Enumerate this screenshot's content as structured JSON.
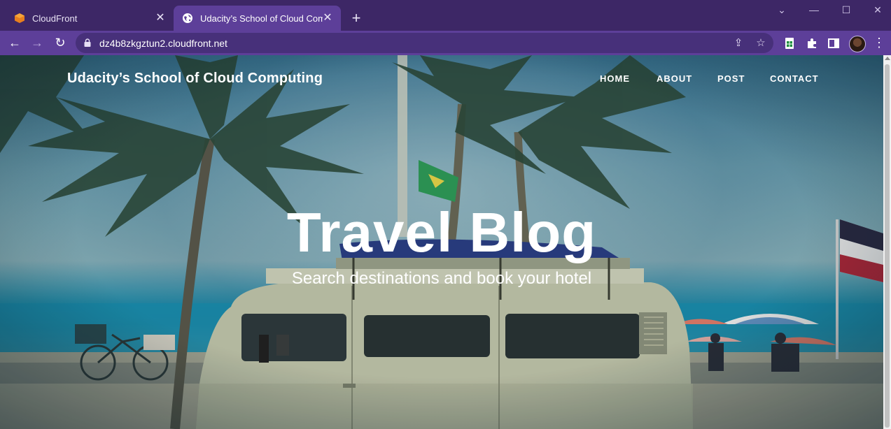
{
  "browser": {
    "tabs": [
      {
        "title": "CloudFront",
        "active": false
      },
      {
        "title": "Udacity’s School of Cloud Computing",
        "active": true
      }
    ],
    "address": "dz4b8zkgztun2.cloudfront.net",
    "colors": {
      "frame": "#3d2766",
      "toolbar": "#5d3f99",
      "omnibox": "#47307a"
    }
  },
  "site": {
    "brand": "Udacity’s School of Cloud Computing",
    "nav": [
      "HOME",
      "ABOUT",
      "POST",
      "CONTACT"
    ],
    "hero": {
      "title": "Travel Blog",
      "subtitle": "Search destinations and book your hotel"
    }
  },
  "icons": [
    "cloudfront-icon",
    "globe-icon",
    "close-icon",
    "plus-icon",
    "back-icon",
    "forward-icon",
    "reload-icon",
    "lock-icon",
    "share-icon",
    "star-icon",
    "sheets-extension-icon",
    "puzzle-icon",
    "sidepanel-icon",
    "avatar",
    "kebab-menu-icon"
  ]
}
